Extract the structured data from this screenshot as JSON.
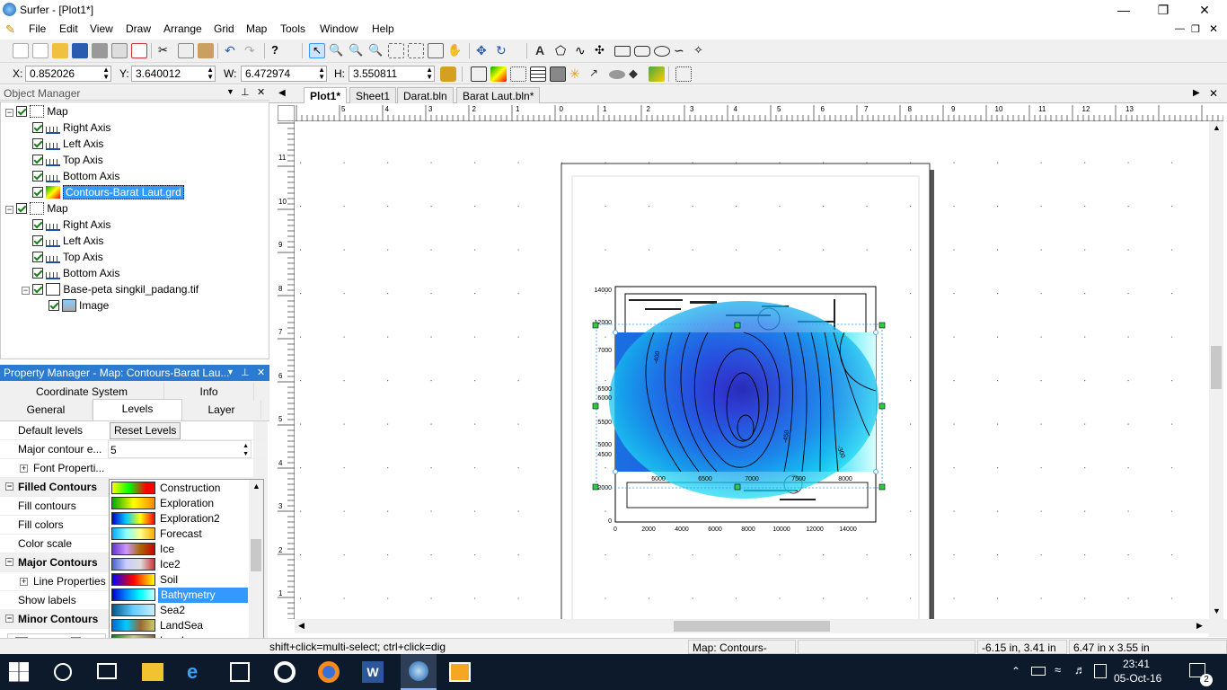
{
  "window": {
    "title": "Surfer - [Plot1*]"
  },
  "menu": [
    "File",
    "Edit",
    "View",
    "Draw",
    "Arrange",
    "Grid",
    "Map",
    "Tools",
    "Window",
    "Help"
  ],
  "position_bar": {
    "x_label": "X:",
    "x_value": "0.852026",
    "y_label": "Y:",
    "y_value": "3.640012",
    "w_label": "W:",
    "w_value": "6.472974",
    "h_label": "H:",
    "h_value": "3.550811"
  },
  "object_manager": {
    "title": "Object Manager",
    "items": [
      {
        "label": "Map",
        "level": 0,
        "icon": "map-frame-icon"
      },
      {
        "label": "Right Axis",
        "level": 1,
        "icon": "axis-icon"
      },
      {
        "label": "Left Axis",
        "level": 1,
        "icon": "axis-icon"
      },
      {
        "label": "Top Axis",
        "level": 1,
        "icon": "axis-icon"
      },
      {
        "label": "Bottom Axis",
        "level": 1,
        "icon": "axis-icon"
      },
      {
        "label": "Contours-Barat Laut.grd",
        "level": 1,
        "icon": "contour-icon",
        "selected": true
      },
      {
        "label": "Map",
        "level": 0,
        "icon": "map-frame-icon"
      },
      {
        "label": "Right Axis",
        "level": 1,
        "icon": "axis-icon"
      },
      {
        "label": "Left Axis",
        "level": 1,
        "icon": "axis-icon"
      },
      {
        "label": "Top Axis",
        "level": 1,
        "icon": "axis-icon"
      },
      {
        "label": "Bottom Axis",
        "level": 1,
        "icon": "axis-icon"
      },
      {
        "label": "Base-peta singkil_padang.tif",
        "level": 1,
        "icon": "base-map-icon"
      },
      {
        "label": "Image",
        "level": 2,
        "icon": "image-icon"
      }
    ]
  },
  "property_manager": {
    "title": "Property Manager - Map: Contours-Barat Lau...",
    "tabs_row1": [
      "Coordinate System",
      "Info"
    ],
    "tabs_row2": [
      "General",
      "Levels",
      "Layer"
    ],
    "active_tab": "Levels",
    "rows": [
      {
        "label": "Default levels",
        "value": "Reset Levels",
        "type": "button"
      },
      {
        "label": "Major contour e...",
        "value": "5",
        "type": "spin"
      },
      {
        "label": "Font Properti...",
        "value": "",
        "type": "expand"
      },
      {
        "label": "Filled Contours",
        "value": "",
        "type": "section"
      },
      {
        "label": "Fill contours",
        "value": "",
        "type": "row"
      },
      {
        "label": "Fill colors",
        "value": "",
        "type": "row"
      },
      {
        "label": "Color scale",
        "value": "",
        "type": "row"
      },
      {
        "label": "Major Contours",
        "value": "",
        "type": "section"
      },
      {
        "label": "Line Properties",
        "value": "",
        "type": "expand"
      },
      {
        "label": "Show labels",
        "value": "",
        "type": "row"
      },
      {
        "label": "Minor Contours",
        "value": "",
        "type": "section"
      }
    ],
    "colorscales": [
      {
        "name": "Construction",
        "grad": "linear-gradient(90deg,#ff0 0%,#0f0 40%,#f00 80%,#f00 100%)"
      },
      {
        "name": "Exploration",
        "grad": "linear-gradient(90deg,#0a0,#ff0,#f80)"
      },
      {
        "name": "Exploration2",
        "grad": "linear-gradient(90deg,#00c,#0cf,#ff0,#f00)"
      },
      {
        "name": "Forecast",
        "grad": "linear-gradient(90deg,#0af,#8ff,#ff8,#fa0)"
      },
      {
        "name": "Ice",
        "grad": "linear-gradient(90deg,#63c,#c9f,#a60,#c00)"
      },
      {
        "name": "Ice2",
        "grad": "linear-gradient(90deg,#46c,#ccf,#ddd,#c33)"
      },
      {
        "name": "Soil",
        "grad": "linear-gradient(90deg,#00f,#f00,#ff0)"
      },
      {
        "name": "Bathymetry",
        "grad": "linear-gradient(90deg,#00c,#08f,#0ff,#cff)",
        "selected": true
      },
      {
        "name": "Sea2",
        "grad": "linear-gradient(90deg,#058,#6cf,#cef)"
      },
      {
        "name": "LandSea",
        "grad": "linear-gradient(90deg,#06c,#0cf,#963,#cc6)"
      },
      {
        "name": "Land",
        "grad": "linear-gradient(90deg,#080,#cc8,#864)"
      }
    ]
  },
  "doc_tabs": [
    "Plot1*",
    "Sheet1",
    "Darat.bln",
    "Barat Laut.bln*"
  ],
  "active_doc_tab": "Plot1*",
  "status": {
    "hint": "shift+click=multi-select; ctrl+click=dig",
    "object": "Map: Contours-Bara...",
    "cursor": "-6.15 in, 3.41 in",
    "size": "6.47 in x 3.55 in"
  },
  "map": {
    "left_axis_top": [
      "14000",
      "12000"
    ],
    "left_axis_mid": [
      "7000",
      "6500",
      "6000",
      "5500",
      "5000",
      "4500"
    ],
    "left_axis_bottom": [
      "2000",
      "0"
    ],
    "bottom_axis": [
      "0",
      "2000",
      "4000",
      "6000",
      "8000",
      "10000",
      "12000",
      "14000"
    ],
    "top_axis_inner": [
      "6000",
      "6500",
      "7000",
      "7500",
      "8000"
    ],
    "contour_labels": [
      "-400",
      "-450",
      "-300"
    ]
  },
  "ruler_h": [
    "5",
    "4",
    "3",
    "2",
    "1",
    "0",
    "1",
    "2",
    "3",
    "4",
    "5",
    "6",
    "7",
    "8",
    "9",
    "10",
    "11",
    "12",
    "13"
  ],
  "ruler_v": [
    "11",
    "10",
    "9",
    "8",
    "7",
    "6",
    "5",
    "4",
    "3",
    "2",
    "1"
  ],
  "taskbar": {
    "time": "23:41",
    "date": "05-Oct-16",
    "notif": "2"
  }
}
